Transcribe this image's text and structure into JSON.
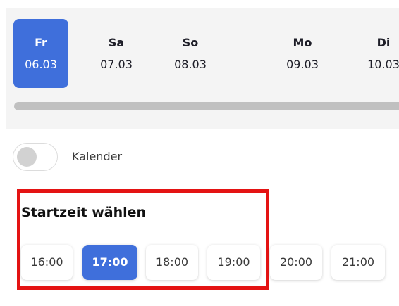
{
  "dates": [
    {
      "day": "Fr",
      "date": "06.03",
      "selected": true
    },
    {
      "day": "Sa",
      "date": "07.03",
      "selected": false
    },
    {
      "day": "So",
      "date": "08.03",
      "selected": false
    },
    {
      "day": "Mo",
      "date": "09.03",
      "selected": false
    },
    {
      "day": "Di",
      "date": "10.03",
      "selected": false
    }
  ],
  "calendar_toggle": {
    "label": "Kalender",
    "on": false
  },
  "start_time": {
    "title": "Startzeit wählen",
    "slots": [
      "16:00",
      "17:00",
      "18:00",
      "19:00",
      "20:00",
      "21:00"
    ],
    "selected": "17:00"
  },
  "colors": {
    "accent": "#3f6fdb",
    "highlight_border": "#e41313"
  }
}
